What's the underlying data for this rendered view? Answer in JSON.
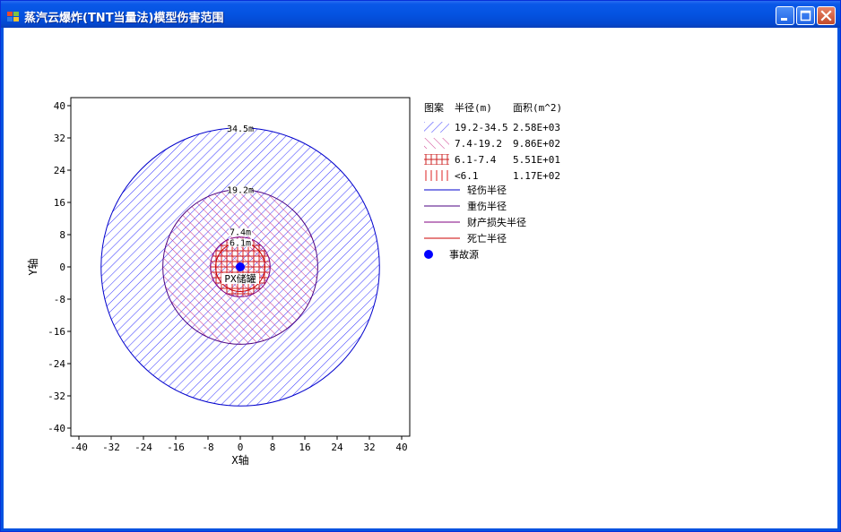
{
  "window": {
    "title": "蒸汽云爆炸(TNT当量法)模型伤害范围",
    "buttons": {
      "minimize": "minimize-icon",
      "maximize": "maximize-icon",
      "close": "close-icon"
    }
  },
  "chart_data": {
    "type": "scatter",
    "title": "",
    "xlabel": "X轴",
    "ylabel": "Y轴",
    "xlim": [
      -42,
      42
    ],
    "ylim": [
      -42,
      42
    ],
    "xticks": [
      -40,
      -32,
      -24,
      -16,
      -8,
      0,
      8,
      16,
      24,
      32,
      40
    ],
    "yticks": [
      -40,
      -32,
      -24,
      -16,
      -8,
      0,
      8,
      16,
      24,
      32,
      40
    ],
    "circles": [
      {
        "name": "轻伤半径",
        "radius": 34.5,
        "label": "34.5m",
        "color": "#0000cc"
      },
      {
        "name": "重伤半径",
        "radius": 19.2,
        "label": "19.2m",
        "color": "#4b0082"
      },
      {
        "name": "财产损失半径",
        "radius": 7.4,
        "label": "7.4m",
        "color": "#800080"
      },
      {
        "name": "死亡半径",
        "radius": 6.1,
        "label": "6.1m",
        "color": "#cc0000"
      }
    ],
    "source": {
      "name": "事故源",
      "x": 0,
      "y": 0,
      "label": "PX储罐",
      "color": "#0000ff"
    },
    "legend": {
      "headers": {
        "pattern": "图案",
        "radius": "半径(m)",
        "area": "面积(m^2)"
      },
      "zones": [
        {
          "range": "19.2-34.5",
          "area": "2.58E+03",
          "pattern": "hatch-blue",
          "color": "#3333ff"
        },
        {
          "range": "7.4-19.2",
          "area": "9.86E+02",
          "pattern": "hatch-magenta",
          "color": "#cc3388"
        },
        {
          "range": "6.1-7.4",
          "area": "5.51E+01",
          "pattern": "cross-red",
          "color": "#cc2222"
        },
        {
          "range": "<6.1",
          "area": "1.17E+02",
          "pattern": "vertical-red",
          "color": "#dd2222"
        }
      ],
      "lines": [
        {
          "label": "轻伤半径",
          "color": "#0000cc"
        },
        {
          "label": "重伤半径",
          "color": "#4b0082"
        },
        {
          "label": "财产损失半径",
          "color": "#800080"
        },
        {
          "label": "死亡半径",
          "color": "#cc0000"
        }
      ],
      "marker": {
        "label": "事故源",
        "color": "#0000ff"
      }
    }
  }
}
